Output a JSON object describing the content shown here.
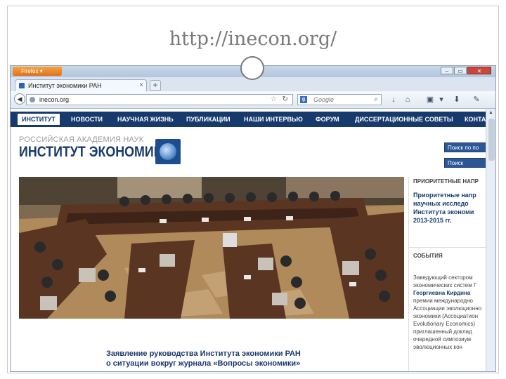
{
  "slide": {
    "title": "http://inecon.org/"
  },
  "browser": {
    "firefox_menu_label": "Firefox ▾",
    "window_controls": [
      "–",
      "▭",
      "✕"
    ],
    "tab": {
      "title": "Институт экономики РАН",
      "close": "×"
    },
    "new_tab": "+",
    "url": "inecon.org",
    "search_engine": "Google",
    "search_engine_glyph": "g",
    "star_glyph": "☆",
    "reload_glyph": "↻",
    "search_glyph": "⌕",
    "back_glyph": "◀",
    "toolbar_icons": [
      "↓",
      "⌂",
      "▣",
      "▾",
      "⬇",
      "✎"
    ]
  },
  "site": {
    "menu": [
      "ИНСТИТУТ",
      "НОВОСТИ",
      "НАУЧНАЯ ЖИЗНЬ",
      "ПУБЛИКАЦИИ",
      "НАШИ ИНТЕРВЬЮ",
      "ФОРУМ",
      "ДИССЕРТАЦИОННЫЕ СОВЕТЫ",
      "КОНТА"
    ],
    "logo_line1": "РОССИЙСКАЯ АКАДЕМИЯ НАУК",
    "logo_line2": "ИНСТИТУТ ЭКОНОМИКИ",
    "search_buttons": [
      "Поиск по по",
      "Поиск"
    ],
    "sidebar": {
      "section1_title": "ПРИОРИТЕТНЫЕ НАПР",
      "section1_link": "Приоритетные напр\nнаучных исследо\nИнститута экономи\n2013-2015 гг.",
      "section2_title": "СОБЫТИЯ",
      "section2_text_a": "Заведующий сектором\nэкономических систем Г",
      "section2_link": "Георгиевна Кирдина",
      "section2_text_b": "премии международно\nАссоциации эволюционно\nэкономики (Ассоциатион\nEvolutionary Economics)\nприглашенный доклад\nочередной симпозиум\nэволюционных кон"
    },
    "news_headline": "Заявление руководства Института экономики РАН\nо ситуации вокруг журнала «Вопросы экономики»"
  },
  "colors": {
    "site_navy": "#173a6d",
    "firefox_orange": "#e0711a",
    "browser_chrome": "#dbe4ef"
  }
}
